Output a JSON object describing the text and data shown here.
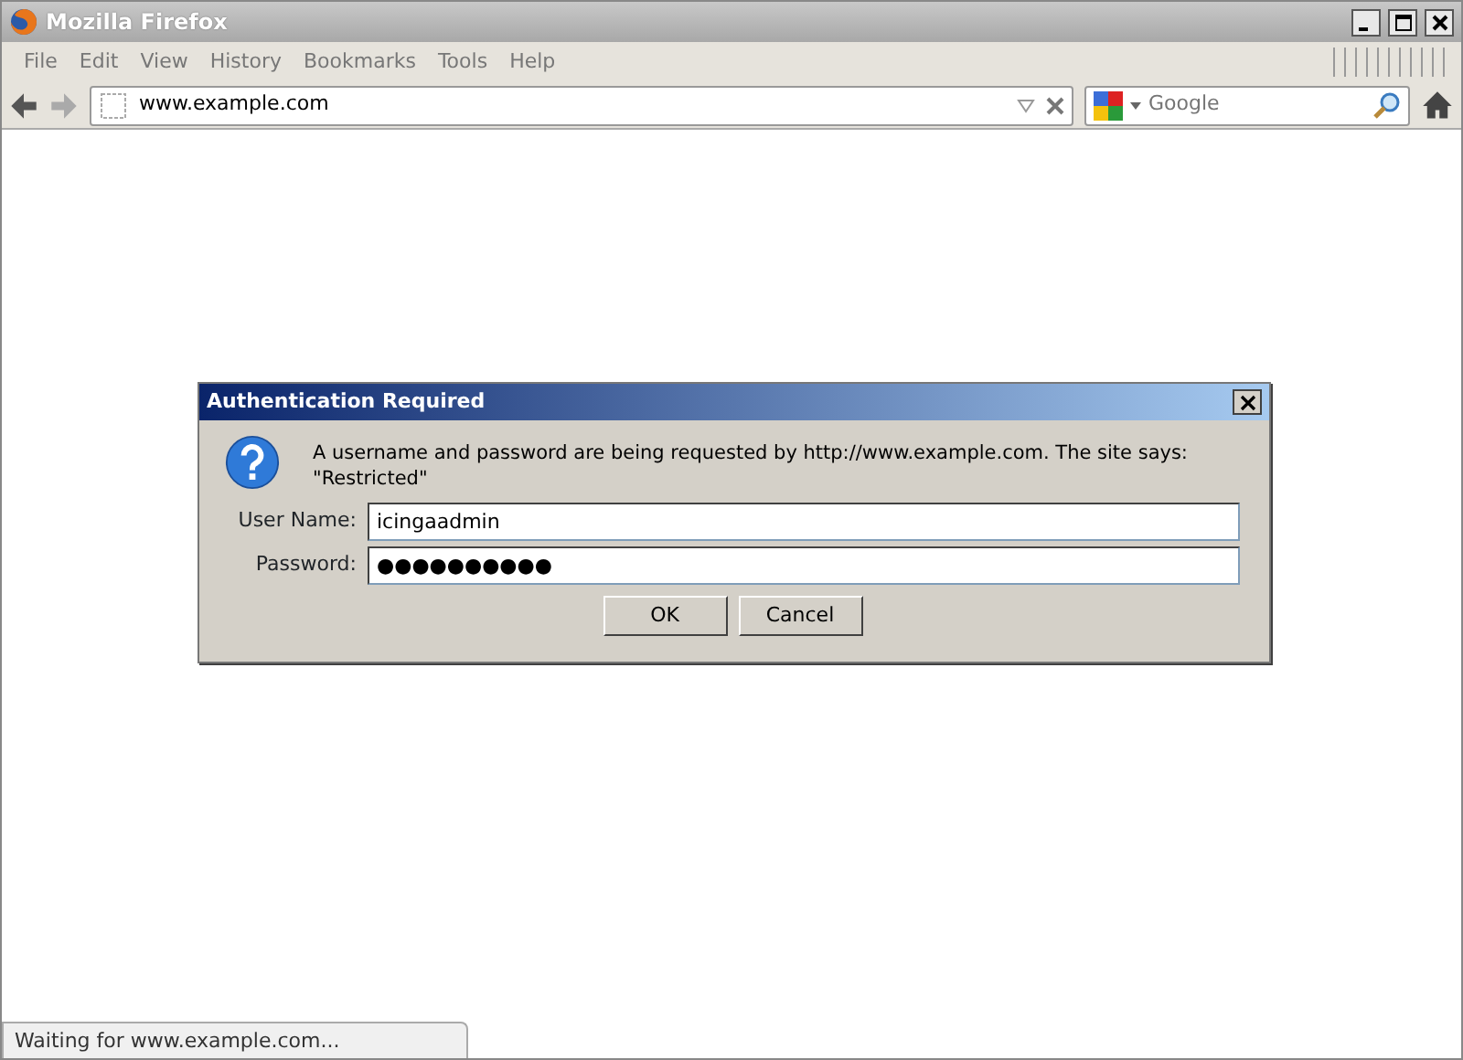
{
  "window": {
    "title": "Mozilla Firefox"
  },
  "menu": [
    "File",
    "Edit",
    "View",
    "History",
    "Bookmarks",
    "Tools",
    "Help"
  ],
  "url_bar": {
    "value": "www.example.com"
  },
  "search": {
    "placeholder": "Google"
  },
  "dialog": {
    "title": "Authentication Required",
    "message": "A username and password are being requested by http://www.example.com. The site says: \"Restricted\"",
    "fields": [
      {
        "label": "User Name:",
        "value": "icingaadmin"
      },
      {
        "label": "Password:",
        "value": "●●●●●●●●●●"
      }
    ],
    "buttons": [
      "OK",
      "Cancel"
    ]
  },
  "status_bar": "Waiting for www.example.com..."
}
